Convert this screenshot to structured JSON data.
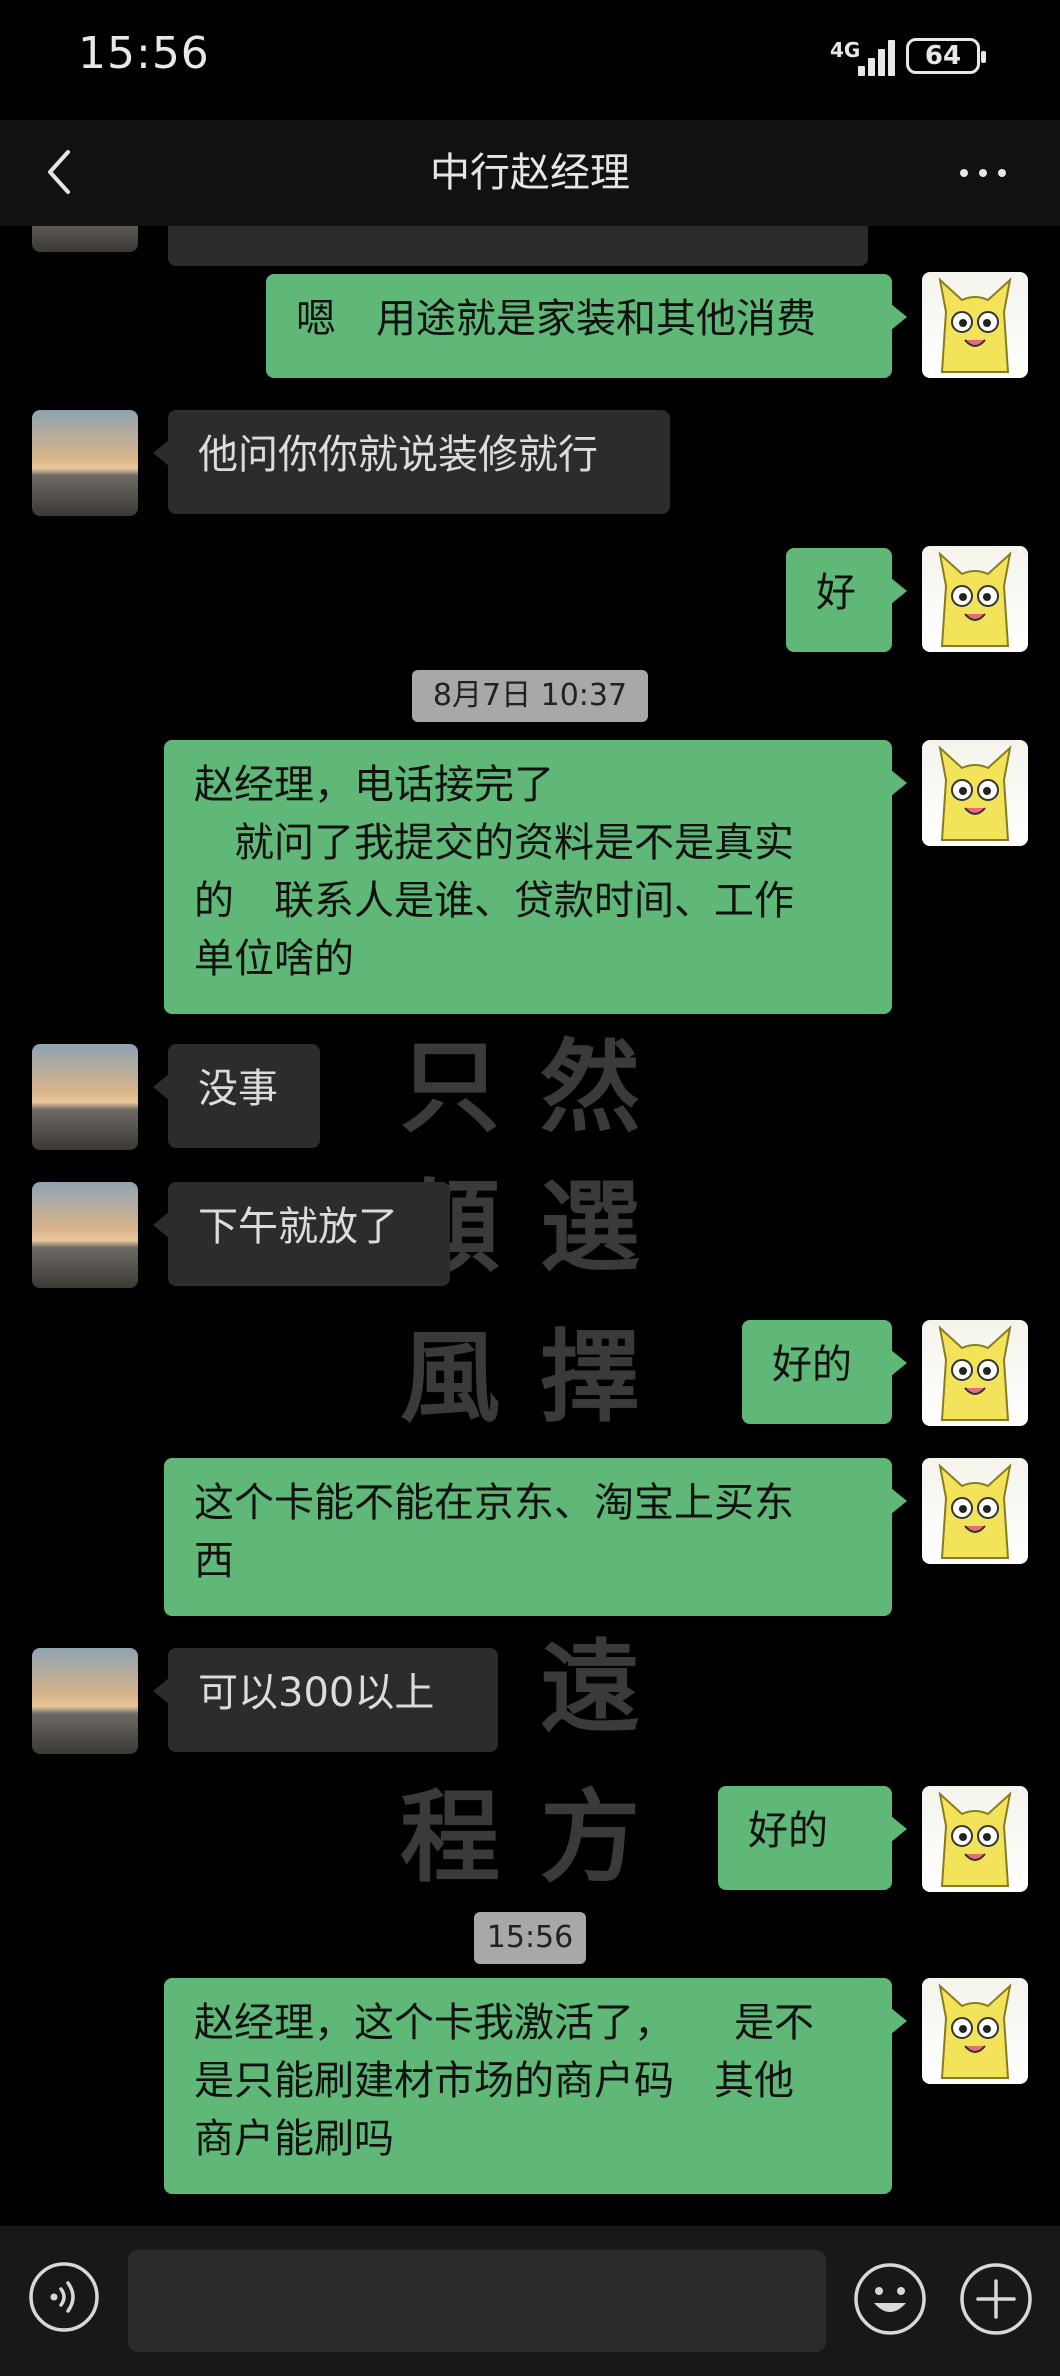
{
  "status": {
    "time": "15:56",
    "network": "4G",
    "battery": "64"
  },
  "header": {
    "title": "中行赵经理"
  },
  "watermark": [
    "只",
    "然",
    "顛",
    "選",
    "風",
    "擇",
    "",
    "遠",
    "程",
    "方"
  ],
  "messages": [
    {
      "side": "out",
      "text": "嗯　用途就是家装和其他消费"
    },
    {
      "side": "in",
      "text": "他问你你就说装修就行"
    },
    {
      "side": "out",
      "text": "好"
    },
    {
      "side": "time",
      "text": "8月7日 10:37"
    },
    {
      "side": "out",
      "text": "赵经理，电话接完了\n　就问了我提交的资料是不是真实\n的　联系人是谁、贷款时间、工作\n单位啥的"
    },
    {
      "side": "in",
      "text": "没事"
    },
    {
      "side": "in",
      "text": "下午就放了"
    },
    {
      "side": "out",
      "text": "好的"
    },
    {
      "side": "out",
      "text": "这个卡能不能在京东、淘宝上买东\n西"
    },
    {
      "side": "in",
      "text": "可以300以上"
    },
    {
      "side": "out",
      "text": "好的"
    },
    {
      "side": "time",
      "text": "15:56"
    },
    {
      "side": "out",
      "text": "赵经理，这个卡我激活了，　　是不\n是只能刷建材市场的商户码　其他\n商户能刷吗"
    }
  ],
  "input": {
    "placeholder": ""
  },
  "colors": {
    "outgoing_bubble": "#5fb878",
    "incoming_bubble": "#2c2c2c",
    "background": "#000000"
  }
}
